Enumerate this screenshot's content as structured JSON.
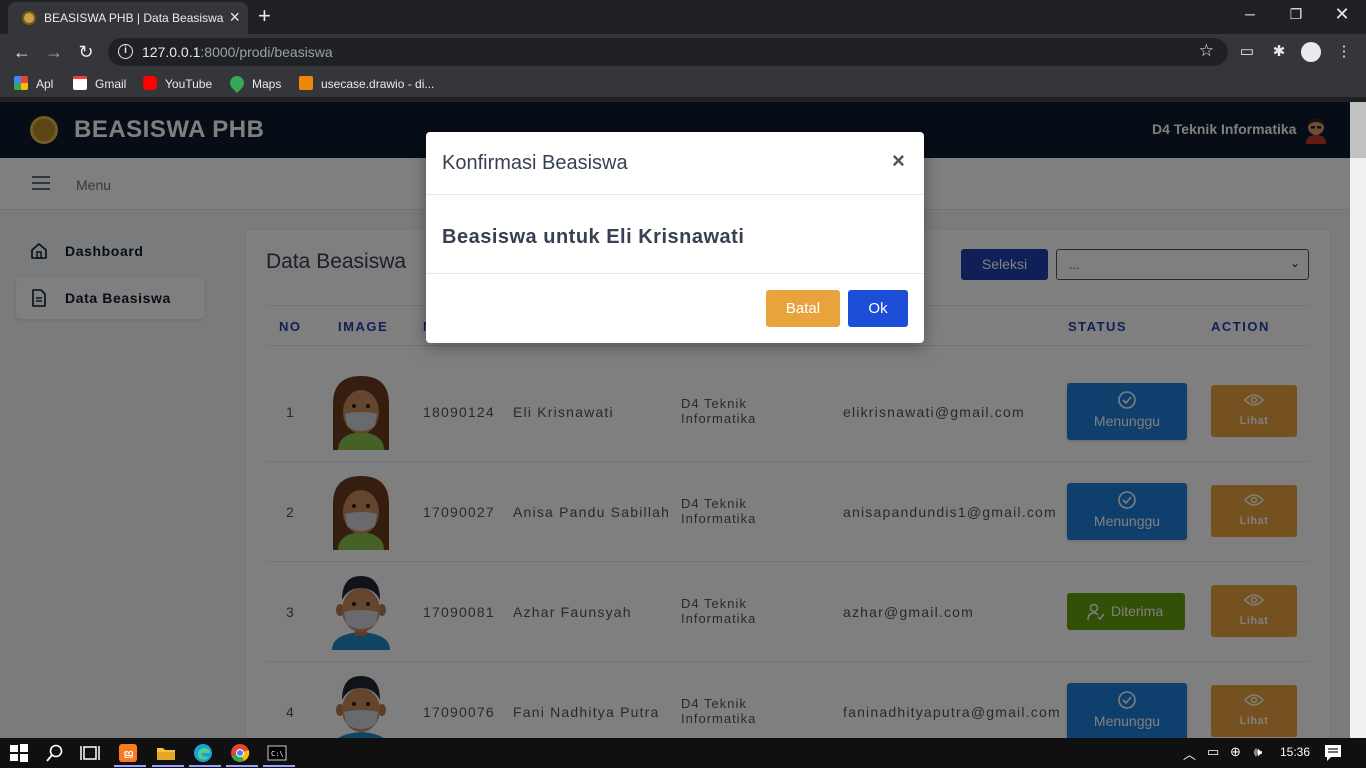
{
  "browser": {
    "tab_title": "BEASISWA PHB | Data Beasiswa",
    "url_host": "127.0.0.1",
    "url_rest": ":8000/prodi/beasiswa",
    "bookmarks": [
      "Apl",
      "Gmail",
      "YouTube",
      "Maps",
      "usecase.drawio - di..."
    ]
  },
  "app": {
    "brand": "BEASISWA PHB",
    "prodi": "D4 Teknik Informatika",
    "menu_label": "Menu",
    "sidebar": [
      {
        "label": "Dashboard",
        "icon": "home-icon"
      },
      {
        "label": "Data Beasiswa",
        "icon": "document-icon"
      }
    ]
  },
  "card": {
    "title": "Data Beasiswa",
    "seleksi_label": "Seleksi",
    "filter_value": "..."
  },
  "table": {
    "headers": {
      "no": "NO",
      "image": "IMAGE",
      "nim": "N",
      "status": "STATUS",
      "action": "ACTION"
    },
    "rows": [
      {
        "no": "1",
        "nim": "18090124",
        "nama": "Eli Krisnawati",
        "prodi": "D4 Teknik Informatika",
        "email": "elikrisnawati@gmail.com",
        "status": "Menunggu",
        "action": "Lihat"
      },
      {
        "no": "2",
        "nim": "17090027",
        "nama": "Anisa Pandu Sabillah",
        "prodi": "D4 Teknik Informatika",
        "email": "anisapandundis1@gmail.com",
        "status": "Menunggu",
        "action": "Lihat"
      },
      {
        "no": "3",
        "nim": "17090081",
        "nama": "Azhar Faunsyah",
        "prodi": "D4 Teknik Informatika",
        "email": "azhar@gmail.com",
        "status": "Diterima",
        "action": "Lihat"
      },
      {
        "no": "4",
        "nim": "17090076",
        "nama": "Fani Nadhitya Putra",
        "prodi": "D4 Teknik Informatika",
        "email": "faninadhityaputra@gmail.com",
        "status": "Menunggu",
        "action": "Lihat"
      }
    ]
  },
  "modal": {
    "title": "Konfirmasi Beasiswa",
    "close": "×",
    "body": "Beasiswa untuk Eli Krisnawati",
    "cancel": "Batal",
    "ok": "Ok"
  },
  "taskbar": {
    "time": "15:36"
  },
  "colors": {
    "header_bg": "#0f1b2d",
    "primary": "#1d4ed8",
    "status_waiting": "#1e7fd8",
    "status_accepted": "#65a30d",
    "action": "#e8a33d"
  }
}
